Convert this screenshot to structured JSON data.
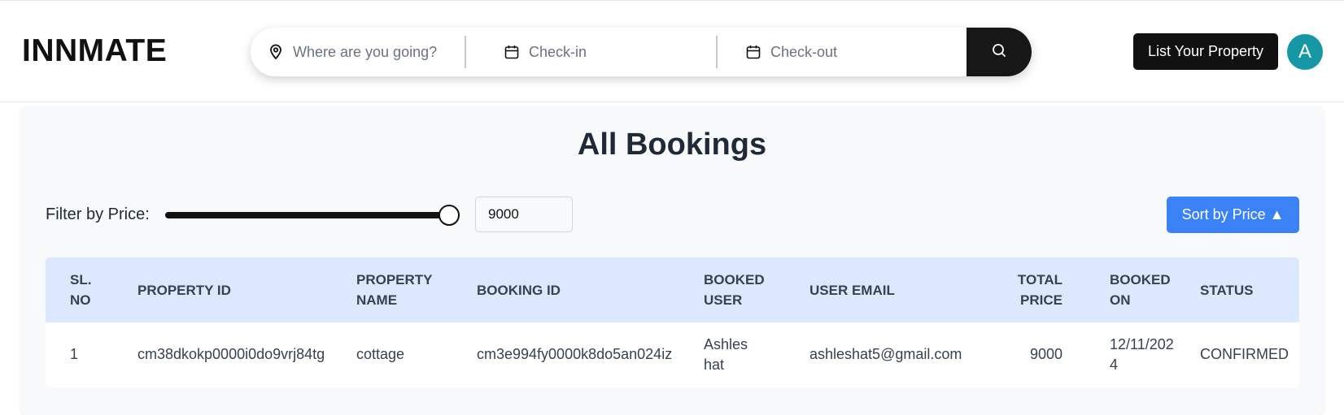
{
  "header": {
    "logo": "INNMATE",
    "search": {
      "where_placeholder": "Where are you going?",
      "checkin_placeholder": "Check-in",
      "checkout_placeholder": "Check-out"
    },
    "list_property_label": "List Your Property",
    "avatar_initial": "A"
  },
  "main": {
    "title": "All Bookings",
    "filter": {
      "label": "Filter by Price:",
      "value": "9000",
      "slider_fraction": 1.0
    },
    "sort_label": "Sort by Price ▲",
    "table": {
      "columns": [
        "SL. NO",
        "PROPERTY ID",
        "PROPERTY NAME",
        "BOOKING ID",
        "BOOKED USER",
        "USER EMAIL",
        "TOTAL PRICE",
        "BOOKED ON",
        "STATUS"
      ],
      "rows": [
        {
          "sl_no": "1",
          "property_id": "cm38dkokp0000i0do9vrj84tg",
          "property_name": "cottage",
          "booking_id": "cm3e994fy0000k8do5an024iz",
          "booked_user": "Ashleshat",
          "user_email": "ashleshat5@gmail.com",
          "total_price": "9000",
          "booked_on": "12/11/2024",
          "status": "CONFIRMED"
        }
      ]
    }
  },
  "colors": {
    "accent_blue": "#3b82f6",
    "avatar_teal": "#1697a6",
    "header_row_bg": "#dbe8fd",
    "dark": "#111111"
  }
}
